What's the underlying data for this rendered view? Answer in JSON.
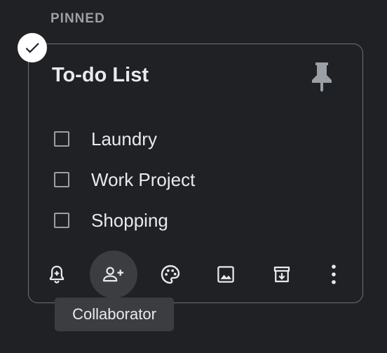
{
  "section": {
    "label": "PINNED"
  },
  "note": {
    "title": "To-do List",
    "selected": true,
    "pinned": true,
    "items": [
      {
        "text": "Laundry",
        "checked": false
      },
      {
        "text": "Work Project",
        "checked": false
      },
      {
        "text": "Shopping",
        "checked": false
      }
    ],
    "toolbar": [
      {
        "icon": "add-alert-icon"
      },
      {
        "icon": "person-add-icon"
      },
      {
        "icon": "palette-icon"
      },
      {
        "icon": "image-icon"
      },
      {
        "icon": "archive-icon"
      },
      {
        "icon": "more-vert-icon"
      }
    ]
  },
  "tooltip": {
    "text": "Collaborator"
  },
  "colors": {
    "background": "#202124",
    "card_border": "#6f7174",
    "text": "#e8eaed",
    "muted": "#9aa0a6",
    "hover": "#3c3d40"
  }
}
